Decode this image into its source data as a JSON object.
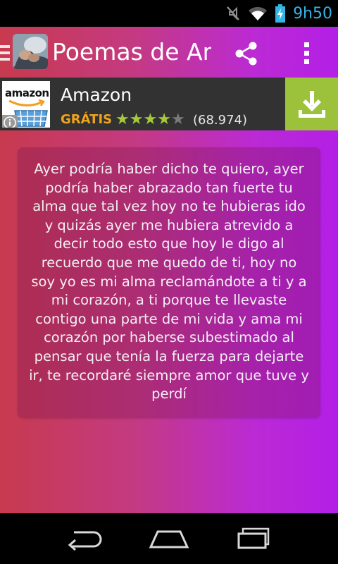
{
  "status_bar": {
    "time": "9h50",
    "accent_color": "#33b5e5",
    "icons": [
      "mute-icon",
      "wifi-icon",
      "battery-charging-icon"
    ]
  },
  "action_bar": {
    "title": "Poemas de Ami",
    "icons": [
      "drawer-indicator-icon",
      "share-icon",
      "overflow-menu-icon"
    ]
  },
  "ad": {
    "logo_text": "amazon",
    "name": "Amazon",
    "price": "GRÁTIS",
    "rating": 4,
    "rating_max": 5,
    "reviews": "(68.974)",
    "price_color": "#f0a31c",
    "download_color": "#9bc23a",
    "icons": [
      "info-icon",
      "download-icon"
    ]
  },
  "poem": {
    "text": "Ayer podría haber dicho te quiero, ayer podría haber abrazado tan fuerte tu alma que tal vez hoy no te hubieras ido y quizás ayer me hubiera atrevido a decir todo esto que hoy le digo al recuerdo que me quedo de ti, hoy no soy yo es mi alma reclamándote a ti y a mi corazón, a ti porque te llevaste contigo una parte de mi vida y ama mi corazón por haberse subestimado al pensar que tenía la fuerza para dejarte ir, te recordaré siempre amor que tuve y perdí"
  },
  "nav_bar": {
    "icons": [
      "back-icon",
      "home-icon",
      "recent-apps-icon"
    ]
  },
  "theme": {
    "gradient_start": "#c73a4e",
    "gradient_end": "#b31fe6"
  }
}
